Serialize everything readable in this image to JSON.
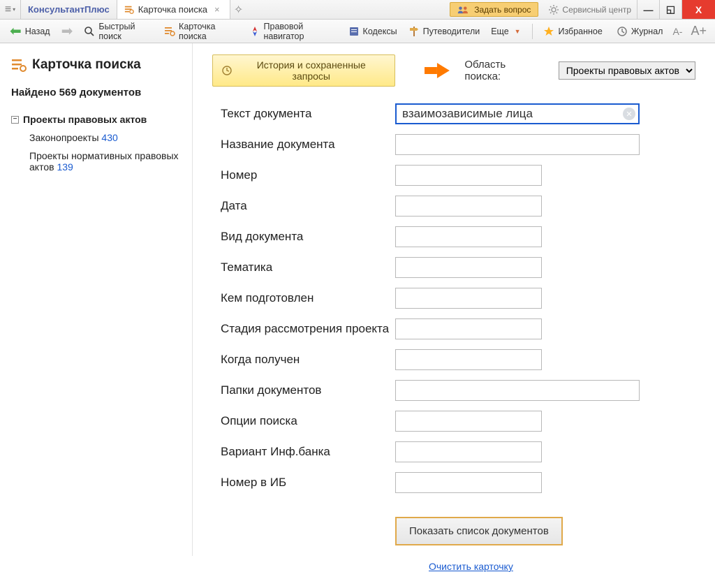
{
  "titlebar": {
    "brand": "КонсультантПлюс",
    "tab_label": "Карточка поиска",
    "ask_label": "Задать вопрос",
    "svc_label": "Сервисный центр"
  },
  "toolbar": {
    "back": "Назад",
    "quick_search": "Быстрый поиск",
    "card_search": "Карточка поиска",
    "legal_nav": "Правовой навигатор",
    "codex": "Кодексы",
    "guides": "Путеводители",
    "more": "Еще",
    "fav": "Избранное",
    "journal": "Журнал"
  },
  "sidebar": {
    "title": "Карточка поиска",
    "found": "Найдено 569 документов",
    "root": "Проекты правовых актов",
    "children": [
      {
        "label": "Законопроекты",
        "count": "430"
      },
      {
        "label": "Проекты нормативных правовых актов",
        "count": "139"
      }
    ]
  },
  "header": {
    "history": "История и сохраненные запросы",
    "area_label": "Область поиска:",
    "area_value": "Проекты правовых актов"
  },
  "form": {
    "rows": [
      {
        "label": "Текст документа",
        "value": "взаимозависимые лица",
        "size": "lg",
        "active": true
      },
      {
        "label": "Название документа",
        "value": "",
        "size": "lg"
      },
      {
        "label": "Номер",
        "value": "",
        "size": "sm"
      },
      {
        "label": "Дата",
        "value": "",
        "size": "sm"
      },
      {
        "label": "Вид документа",
        "value": "",
        "size": "sm"
      },
      {
        "label": "Тематика",
        "value": "",
        "size": "sm"
      },
      {
        "label": "Кем подготовлен",
        "value": "",
        "size": "sm"
      },
      {
        "label": "Стадия рассмотрения проекта",
        "value": "",
        "size": "sm"
      },
      {
        "label": "Когда получен",
        "value": "",
        "size": "sm"
      },
      {
        "label": "Папки документов",
        "value": "",
        "size": "lg"
      },
      {
        "label": "Опции поиска",
        "value": "",
        "size": "sm"
      },
      {
        "label": "Вариант Инф.банка",
        "value": "",
        "size": "sm"
      },
      {
        "label": "Номер в ИБ",
        "value": "",
        "size": "sm"
      }
    ]
  },
  "actions": {
    "show": "Показать список документов",
    "clear": "Очистить карточку"
  }
}
